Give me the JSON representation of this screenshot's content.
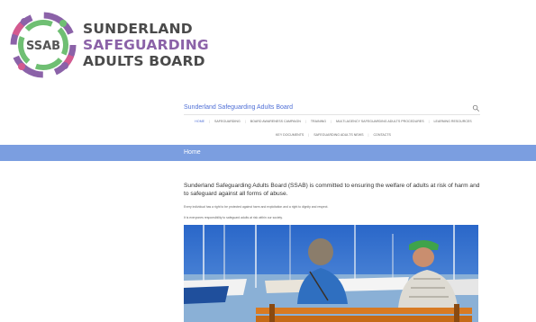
{
  "logo": {
    "badge": "SSAB",
    "line1": "SUNDERLAND",
    "line2": "SAFEGUARDING",
    "line3": "ADULTS BOARD"
  },
  "header": {
    "site_title": "Sunderland Safeguarding Adults Board",
    "search_icon": "search-icon"
  },
  "nav": {
    "row1": [
      "Home",
      "Safeguarding",
      "Board Awareness Campaign",
      "Training",
      "Multi-Agency Safeguarding Adults Procedures",
      "Learning Resources"
    ],
    "row2": [
      "Key Documents",
      "Safeguarding Adults News",
      "Contacts"
    ]
  },
  "home_bar": {
    "label": "Home"
  },
  "main": {
    "intro": "Sunderland Safeguarding Adults Board (SSAB) is committed to ensuring the welfare of adults at risk of harm and to safeguard against all forms of abuse.",
    "para1": "Every individual has a right to be protected against harm and exploitation and a right to dignity and respect.",
    "para2": "It is everyones responsibility to safeguard adults at risk within our society."
  },
  "colors": {
    "accent_blue": "#4f6fd6",
    "home_bar": "#7b9ee0",
    "logo_purple": "#8b62a8",
    "logo_green": "#6fbf73",
    "logo_pink": "#d45a8f"
  }
}
